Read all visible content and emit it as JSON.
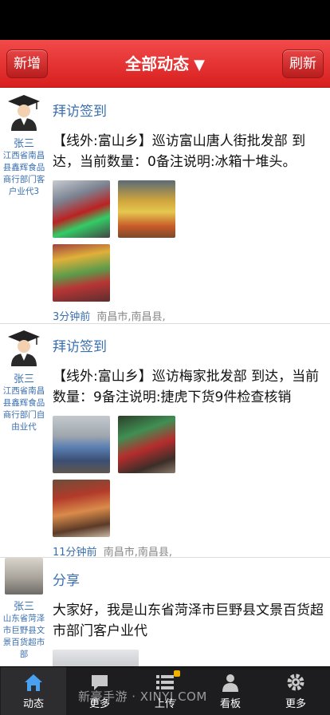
{
  "header": {
    "left_button": "新增",
    "title": "全部动态",
    "title_caret": "▼",
    "right_button": "刷新"
  },
  "posts": [
    {
      "author_name": "张三",
      "author_dept": "江西省南昌县鑫辉食品商行部门客户业代3",
      "type": "拜访签到",
      "text": "【线外:富山乡】巡访富山唐人街批发部 到达，当前数量：0备注说明:冰箱十堆头。",
      "time": "3分钟前",
      "location": "南昌市,南昌县,"
    },
    {
      "author_name": "张三",
      "author_dept": "江西省南昌县鑫辉食品商行部门自由业代",
      "type": "拜访签到",
      "text": "【线外:富山乡】巡访梅家批发部 到达，当前数量：9备注说明:捷虎下货9件检查核销",
      "time": "11分钟前",
      "location": "南昌市,南昌县,"
    },
    {
      "author_name": "张三",
      "author_dept": "山东省菏泽市巨野县文景百货超市部",
      "type": "分享",
      "text": "大家好，我是山东省菏泽市巨野县文景百货超市部门客户业代"
    }
  ],
  "tabbar": {
    "items": [
      {
        "label": "动态",
        "icon": "home-icon"
      },
      {
        "label": "更多",
        "icon": "chat-icon"
      },
      {
        "label": "上传",
        "icon": "list-icon"
      },
      {
        "label": "看板",
        "icon": "person-icon"
      },
      {
        "label": "更多",
        "icon": "gear-icon"
      }
    ]
  },
  "watermark": "新豪手游 · XINYI.COM",
  "colors": {
    "header_red": "#e03030",
    "link_blue": "#3a6fb0",
    "tabbar_bg": "#1d1d1f",
    "badge_yellow": "#f0b000"
  }
}
